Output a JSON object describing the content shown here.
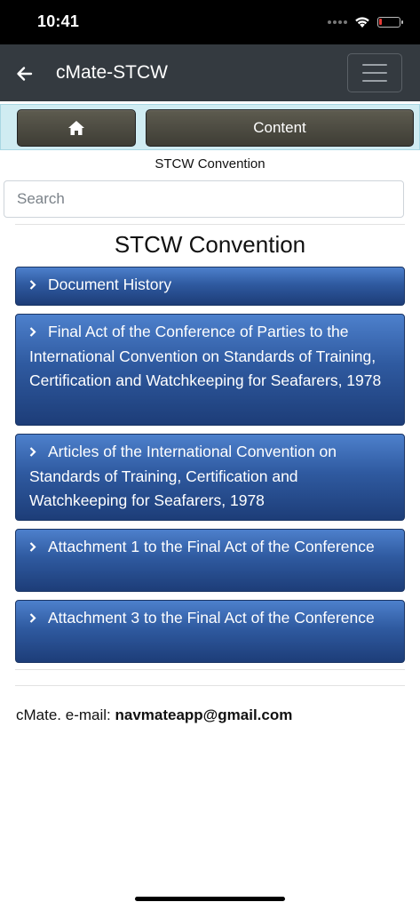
{
  "status_bar": {
    "time": "10:41",
    "battery_color": "#e53935",
    "battery_level": 0.15
  },
  "navbar": {
    "back_icon": "arrow-left-icon",
    "title": "cMate-STCW",
    "menu_icon": "hamburger-menu-icon"
  },
  "toolbar": {
    "home_icon": "home-icon",
    "content_label": "Content"
  },
  "breadcrumb": "STCW Convention",
  "search": {
    "placeholder": "Search",
    "value": ""
  },
  "main": {
    "title": "STCW Convention",
    "items": [
      {
        "label": "Document History"
      },
      {
        "label": "Final Act of the Conference of Parties to the International Convention on Standards of Training, Certification and Watchkeeping for Seafarers, 1978"
      },
      {
        "label": "Articles of the International Convention on Standards of Training, Certification and Watchkeeping for Seafarers, 1978"
      },
      {
        "label": "Attachment 1 to the Final Act of the Conference"
      },
      {
        "label": "Attachment 3 to the Final Act of the Conference"
      }
    ]
  },
  "footer": {
    "prefix": "cMate. e-mail: ",
    "email": "navmateapp@gmail.com"
  },
  "colors": {
    "navbar": "#343a40",
    "toolbar_bg": "#d0ecf2",
    "item_blue": "#2f5aa0"
  }
}
